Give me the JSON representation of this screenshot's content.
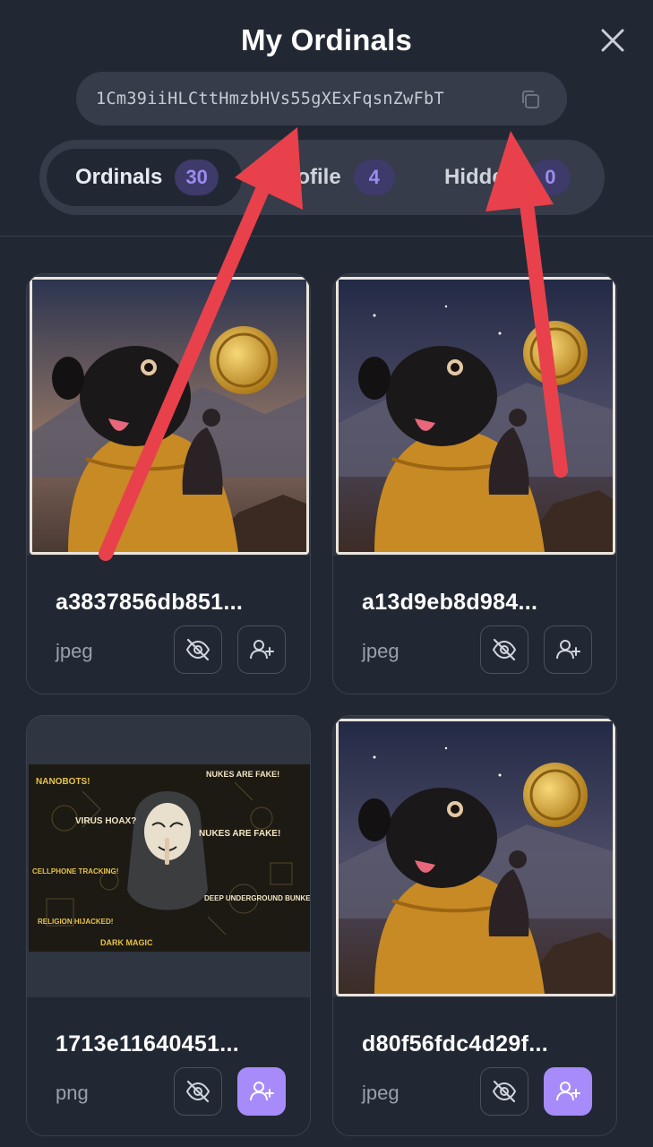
{
  "header": {
    "title": "My Ordinals",
    "address": "1Cm39iiHLCttHmzbHVs55gXExFqsnZwFbT"
  },
  "tabs": [
    {
      "label": "Ordinals",
      "count": "30",
      "active": true
    },
    {
      "label": "Profile",
      "count": "4",
      "active": false
    },
    {
      "label": "Hidden",
      "count": "0",
      "active": false
    }
  ],
  "cards": [
    {
      "name": "a3837856db851...",
      "type": "jpeg",
      "assign_active": false
    },
    {
      "name": "a13d9eb8d984...",
      "type": "jpeg",
      "assign_active": false
    },
    {
      "name": "1713e11640451...",
      "type": "png",
      "assign_active": true
    },
    {
      "name": "d80f56fdc4d29f...",
      "type": "jpeg",
      "assign_active": true
    }
  ],
  "poster_text": [
    "NANOBOTS!",
    "NUKES ARE FAKE!",
    "VIRUS HOAX?",
    "NUKES ARE FAKE!",
    "CELLPHONE TRACKING!",
    "RELIGION HIJACKED!",
    "DEEP UNDERGROUND BUNKERS",
    "DARK MAGIC"
  ],
  "colors": {
    "background": "#222833",
    "pill": "#363c49",
    "accent": "#a78bfa",
    "badge_bg": "#3e3a6a",
    "badge_text": "#9b8cf0",
    "annotation_arrow": "#e8414b"
  },
  "icons": [
    "close-icon",
    "copy-icon",
    "eye-off-icon",
    "user-plus-icon"
  ]
}
